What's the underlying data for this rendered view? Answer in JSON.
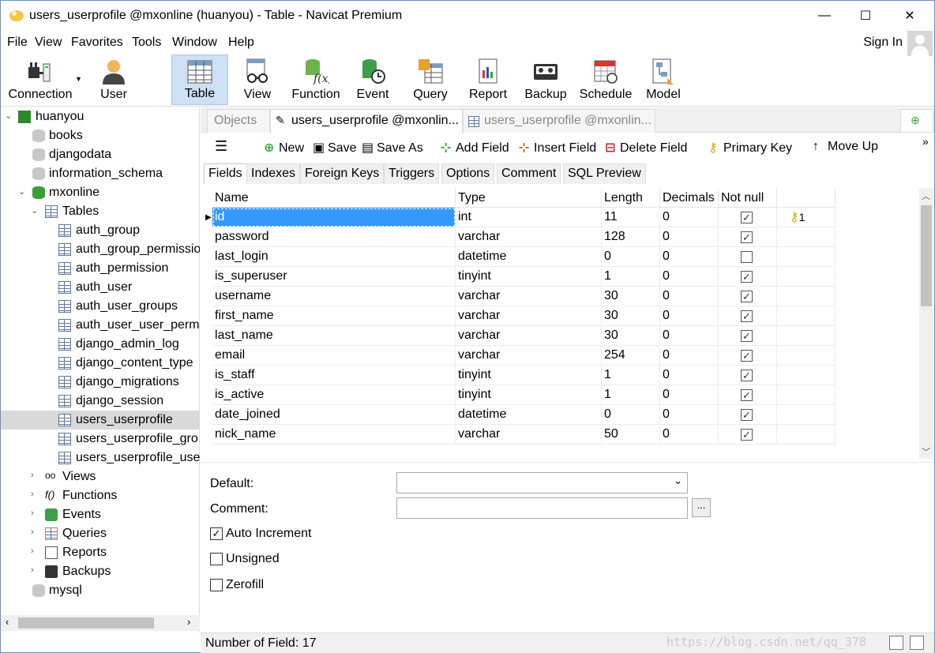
{
  "window": {
    "title": "users_userprofile @mxonline (huanyou) - Table - Navicat Premium",
    "min_glyph": "—",
    "max_glyph": "☐",
    "close_glyph": "✕"
  },
  "menu": [
    "File",
    "View",
    "Favorites",
    "Tools",
    "Window",
    "Help"
  ],
  "account": {
    "sign_in": "Sign In"
  },
  "ribbon": [
    {
      "label": "Connection",
      "icon": "connection-plug-icon"
    },
    {
      "label": "User",
      "icon": "user-icon"
    },
    {
      "label": "Table",
      "icon": "table-icon",
      "active": true
    },
    {
      "label": "View",
      "icon": "view-glasses-icon"
    },
    {
      "label": "Function",
      "icon": "function-icon"
    },
    {
      "label": "Event",
      "icon": "event-clock-icon"
    },
    {
      "label": "Query",
      "icon": "query-icon"
    },
    {
      "label": "Report",
      "icon": "report-icon"
    },
    {
      "label": "Backup",
      "icon": "backup-tape-icon"
    },
    {
      "label": "Schedule",
      "icon": "schedule-calendar-icon"
    },
    {
      "label": "Model",
      "icon": "model-icon"
    }
  ],
  "tree": {
    "connection": "huanyou",
    "databases": [
      "books",
      "djangodata",
      "information_schema"
    ],
    "active_db": "mxonline",
    "tables_label": "Tables",
    "tables": [
      "auth_group",
      "auth_group_permissio",
      "auth_permission",
      "auth_user",
      "auth_user_groups",
      "auth_user_user_permi",
      "django_admin_log",
      "django_content_type",
      "django_migrations",
      "django_session",
      "users_userprofile",
      "users_userprofile_gro",
      "users_userprofile_use"
    ],
    "selected_table": "users_userprofile",
    "groups": [
      "Views",
      "Functions",
      "Events",
      "Queries",
      "Reports",
      "Backups"
    ],
    "last_db": "mysql"
  },
  "tabs": {
    "objects": "Objects",
    "design": "users_userprofile @mxonlin...",
    "data": "users_userprofile @mxonlin..."
  },
  "editor_toolbar": {
    "new": "New",
    "save": "Save",
    "save_as": "Save As",
    "add_field": "Add Field",
    "insert_field": "Insert Field",
    "delete_field": "Delete Field",
    "primary_key": "Primary Key",
    "move_up": "Move Up",
    "more": "»"
  },
  "subtabs": [
    "Fields",
    "Indexes",
    "Foreign Keys",
    "Triggers",
    "Options",
    "Comment",
    "SQL Preview"
  ],
  "grid": {
    "headers": [
      "Name",
      "Type",
      "Length",
      "Decimals",
      "Not null",
      ""
    ],
    "rows": [
      {
        "name": "id",
        "type": "int",
        "length": "11",
        "decimals": "0",
        "not_null": true,
        "key": "1"
      },
      {
        "name": "password",
        "type": "varchar",
        "length": "128",
        "decimals": "0",
        "not_null": true,
        "key": ""
      },
      {
        "name": "last_login",
        "type": "datetime",
        "length": "0",
        "decimals": "0",
        "not_null": false,
        "key": ""
      },
      {
        "name": "is_superuser",
        "type": "tinyint",
        "length": "1",
        "decimals": "0",
        "not_null": true,
        "key": ""
      },
      {
        "name": "username",
        "type": "varchar",
        "length": "30",
        "decimals": "0",
        "not_null": true,
        "key": ""
      },
      {
        "name": "first_name",
        "type": "varchar",
        "length": "30",
        "decimals": "0",
        "not_null": true,
        "key": ""
      },
      {
        "name": "last_name",
        "type": "varchar",
        "length": "30",
        "decimals": "0",
        "not_null": true,
        "key": ""
      },
      {
        "name": "email",
        "type": "varchar",
        "length": "254",
        "decimals": "0",
        "not_null": true,
        "key": ""
      },
      {
        "name": "is_staff",
        "type": "tinyint",
        "length": "1",
        "decimals": "0",
        "not_null": true,
        "key": ""
      },
      {
        "name": "is_active",
        "type": "tinyint",
        "length": "1",
        "decimals": "0",
        "not_null": true,
        "key": ""
      },
      {
        "name": "date_joined",
        "type": "datetime",
        "length": "0",
        "decimals": "0",
        "not_null": true,
        "key": ""
      },
      {
        "name": "nick_name",
        "type": "varchar",
        "length": "50",
        "decimals": "0",
        "not_null": true,
        "key": ""
      }
    ]
  },
  "properties": {
    "default_label": "Default:",
    "default_value": "",
    "comment_label": "Comment:",
    "comment_value": "",
    "browse": "...",
    "auto_increment": {
      "label": "Auto Increment",
      "checked": true
    },
    "unsigned": {
      "label": "Unsigned",
      "checked": false
    },
    "zerofill": {
      "label": "Zerofill",
      "checked": false
    }
  },
  "status": {
    "fields": "Number of Field: 17",
    "watermark": "https://blog.csdn.net/qq_378"
  }
}
